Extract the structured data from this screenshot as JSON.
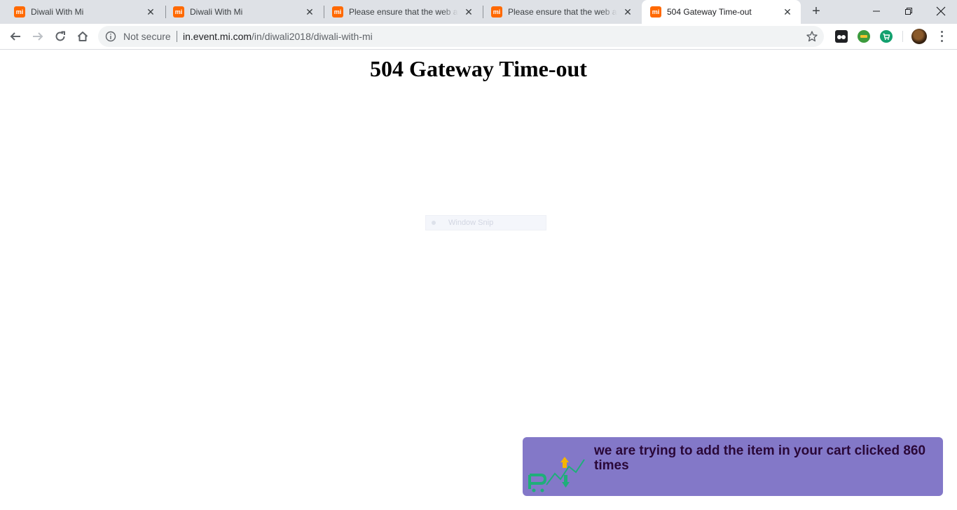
{
  "browser": {
    "tabs": [
      {
        "title": "Diwali With Mi",
        "favicon": "mi-logo-icon",
        "active": false
      },
      {
        "title": "Diwali With Mi",
        "favicon": "mi-logo-icon",
        "active": false
      },
      {
        "title": "Please ensure that the web address",
        "favicon": "mi-logo-icon",
        "active": false
      },
      {
        "title": "Please ensure that the web address",
        "favicon": "mi-logo-icon",
        "active": false
      },
      {
        "title": "504 Gateway Time-out",
        "favicon": "mi-logo-icon",
        "active": true
      }
    ],
    "favicon_text": "mi",
    "new_tab_glyph": "+",
    "close_glyph": "✕",
    "window_controls": {
      "minimize": "—",
      "maximize": "❐",
      "close": "✕"
    },
    "address_bar": {
      "security_label": "Not secure",
      "host": "in.event.mi.com",
      "path": "/in/diwali2018/diwali-with-mi"
    },
    "extensions": [
      "dual-circle-extension-icon",
      "green-yellow-extension-icon",
      "shopping-cart-extension-icon"
    ],
    "colors": {
      "tabstrip": "#dee1e6",
      "favicon": "#ff6900",
      "toast_bg": "#8378c8",
      "toast_text": "#2a0838"
    }
  },
  "page": {
    "heading": "504 Gateway Time-out",
    "ghost_overlay_label": "Window Snip"
  },
  "notification": {
    "message": "we are trying to add the item in your cart clicked 860 times",
    "logo": "cart-arrows-logo-icon"
  }
}
